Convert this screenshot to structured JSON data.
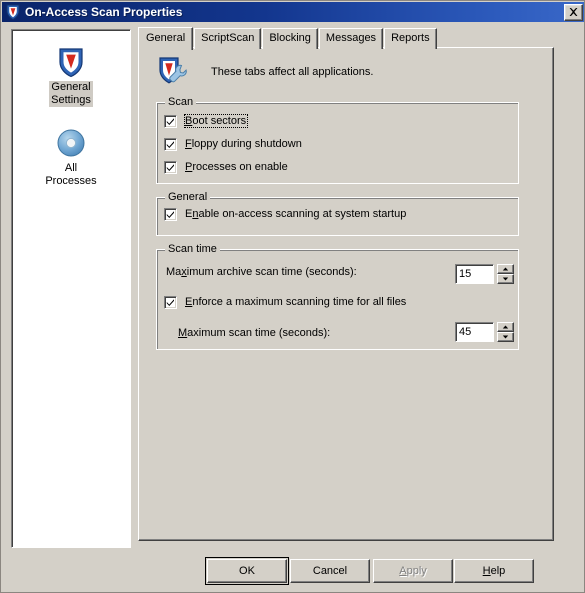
{
  "window": {
    "title": "On-Access Scan Properties",
    "title_icon": "mcafee-shield-icon",
    "close_label": "×"
  },
  "sidebar": {
    "items": [
      {
        "label": "General\nSettings",
        "icon": "shield-icon",
        "selected": true
      },
      {
        "label": "All\nProcesses",
        "icon": "disc-icon",
        "selected": false
      }
    ]
  },
  "tabs": [
    {
      "label": "General",
      "active": true
    },
    {
      "label": "ScriptScan",
      "active": false
    },
    {
      "label": "Blocking",
      "active": false
    },
    {
      "label": "Messages",
      "active": false
    },
    {
      "label": "Reports",
      "active": false
    }
  ],
  "banner": {
    "icon": "shield-wrench-icon",
    "text": "These tabs affect all applications."
  },
  "groups": {
    "scan": {
      "title": "Scan",
      "items": [
        {
          "pre": "",
          "acc": "B",
          "post": "oot sectors",
          "checked": true,
          "focused": true
        },
        {
          "pre": "",
          "acc": "F",
          "post": "loppy during shutdown",
          "checked": true,
          "focused": false
        },
        {
          "pre": "",
          "acc": "P",
          "post": "rocesses on enable",
          "checked": true,
          "focused": false
        }
      ]
    },
    "general": {
      "title": "General",
      "items": [
        {
          "pre": "E",
          "acc": "n",
          "post": "able on-access scanning at system startup",
          "checked": true,
          "focused": false
        }
      ]
    },
    "scan_time": {
      "title": "Scan time",
      "archive_label_pre": "Ma",
      "archive_label_acc": "x",
      "archive_label_post": "imum archive scan time (seconds):",
      "archive_value": "15",
      "enforce_pre": "",
      "enforce_acc": "E",
      "enforce_post": "nforce a maximum scanning time for all files",
      "enforce_checked": true,
      "max_label_pre": "",
      "max_label_acc": "M",
      "max_label_post": "aximum scan time (seconds):",
      "max_value": "45"
    }
  },
  "buttons": {
    "ok": {
      "label": "OK",
      "default": true,
      "disabled": false
    },
    "cancel": {
      "label": "Cancel",
      "default": false,
      "disabled": false
    },
    "apply": {
      "pre": "",
      "acc": "A",
      "post": "pply",
      "default": false,
      "disabled": true
    },
    "help": {
      "pre": "",
      "acc": "H",
      "post": "elp",
      "default": false,
      "disabled": false
    }
  },
  "colors": {
    "dialog_face": "#d4d0c8",
    "titlebar_start": "#0a246a",
    "titlebar_end": "#3a68c8",
    "shield_blue": "#2a5fb0",
    "shield_red": "#d32a1e",
    "disc_blue": "#6fa8d6",
    "disabled_text": "#808080"
  }
}
